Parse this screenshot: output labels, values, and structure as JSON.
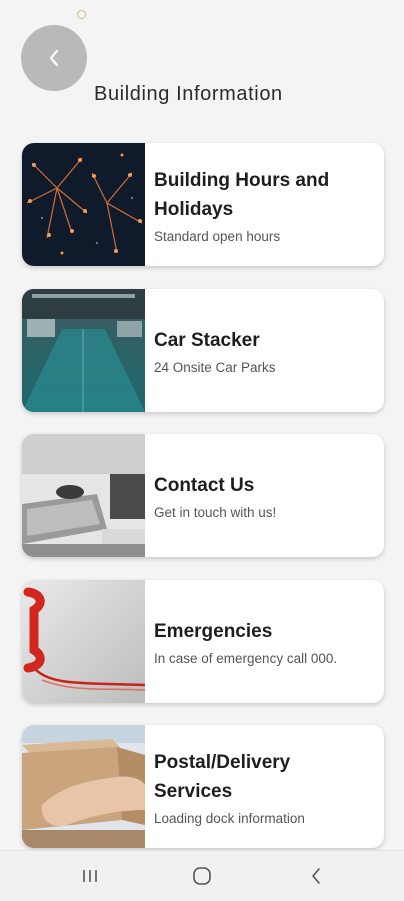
{
  "header": {
    "title": "Building Information",
    "back_icon": "chevron-left-icon"
  },
  "cards": [
    {
      "title": "Building Hours and Holidays",
      "subtitle": "Standard open hours",
      "image": "fireworks-image"
    },
    {
      "title": "Car Stacker",
      "subtitle": "24 Onsite Car Parks",
      "image": "car-park-image"
    },
    {
      "title": "Contact Us",
      "subtitle": "Get in touch with us!",
      "image": "office-desk-image"
    },
    {
      "title": "Emergencies",
      "subtitle": "In case of emergency call 000.",
      "image": "red-phone-image"
    },
    {
      "title": "Postal/Delivery Services",
      "subtitle": "Loading dock information",
      "image": "delivery-box-image"
    }
  ],
  "navbar": {
    "icons": [
      "recent-apps-icon",
      "home-icon",
      "back-icon"
    ]
  },
  "colors": {
    "background": "#f4f4f4",
    "back_button": "#b9b9b9",
    "card": "#ffffff"
  }
}
